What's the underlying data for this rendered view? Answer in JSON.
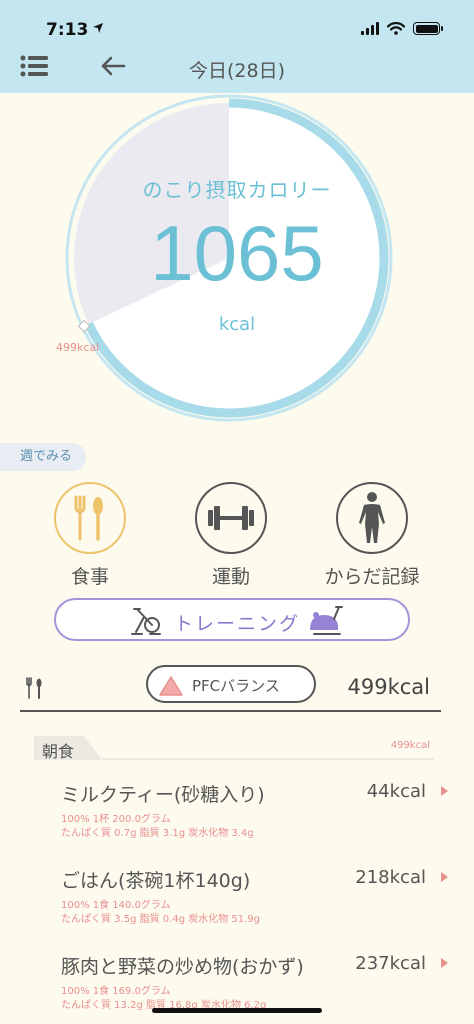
{
  "status_bar": {
    "time": "7:13"
  },
  "header": {
    "title": "今日(28日)"
  },
  "dial": {
    "label": "のこり摂取カロリー",
    "value": "1065",
    "unit": "kcal",
    "marker_label": "499kcal",
    "consumed_fraction": 0.32
  },
  "week_button": {
    "label": "週でみる"
  },
  "categories": [
    {
      "label": "食事",
      "icon": "cutlery-icon"
    },
    {
      "label": "運動",
      "icon": "dumbbell-icon"
    },
    {
      "label": "からだ記録",
      "icon": "body-icon"
    }
  ],
  "training_button": {
    "label": "トレーニング"
  },
  "summary": {
    "pfc_label": "PFCバランス",
    "total_kcal": "499kcal"
  },
  "meal": {
    "title": "朝食",
    "kcal": "499kcal",
    "items": [
      {
        "name": "ミルクティー(砂糖入り)",
        "kcal": "44kcal",
        "detail1": "100% 1杯 200.0グラム",
        "detail2": "たんぱく質 0.7g 脂質 3.1g 炭水化物 3.4g"
      },
      {
        "name": "ごはん(茶碗1杯140g)",
        "kcal": "218kcal",
        "detail1": "100% 1食 140.0グラム",
        "detail2": "たんぱく質 3.5g 脂質 0.4g 炭水化物 51.9g"
      },
      {
        "name": "豚肉と野菜の炒め物(おかず)",
        "kcal": "237kcal",
        "detail1": "100% 1食 169.0グラム",
        "detail2": "たんぱく質 13.2g 脂質 16.8g 炭水化物 6.2g"
      }
    ]
  },
  "colors": {
    "header_bg": "#c3e6f0",
    "accent_blue": "#6cc0d6",
    "accent_pink": "#e8908e",
    "accent_purple": "#8c78cf",
    "food_gold": "#eec36b"
  }
}
